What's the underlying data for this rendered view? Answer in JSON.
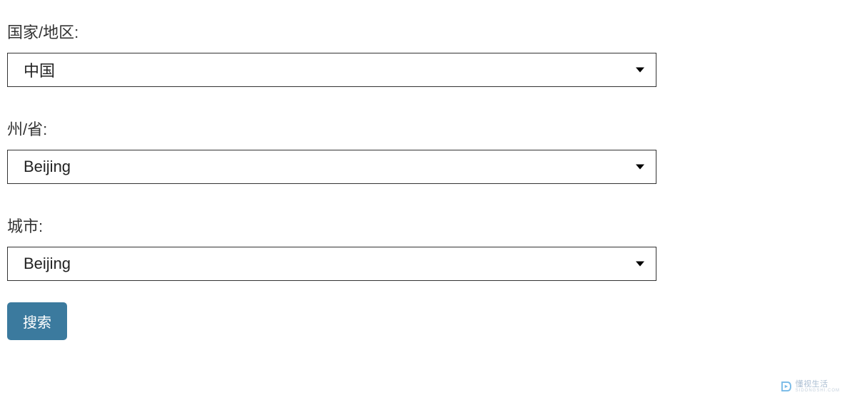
{
  "form": {
    "country": {
      "label": "国家/地区:",
      "value": "中国"
    },
    "province": {
      "label": "州/省:",
      "value": "Beijing"
    },
    "city": {
      "label": "城市:",
      "value": "Beijing"
    },
    "search_label": "搜索"
  },
  "watermark": {
    "text": "懂视生活",
    "sub": "SIDONGSHI.COM"
  }
}
